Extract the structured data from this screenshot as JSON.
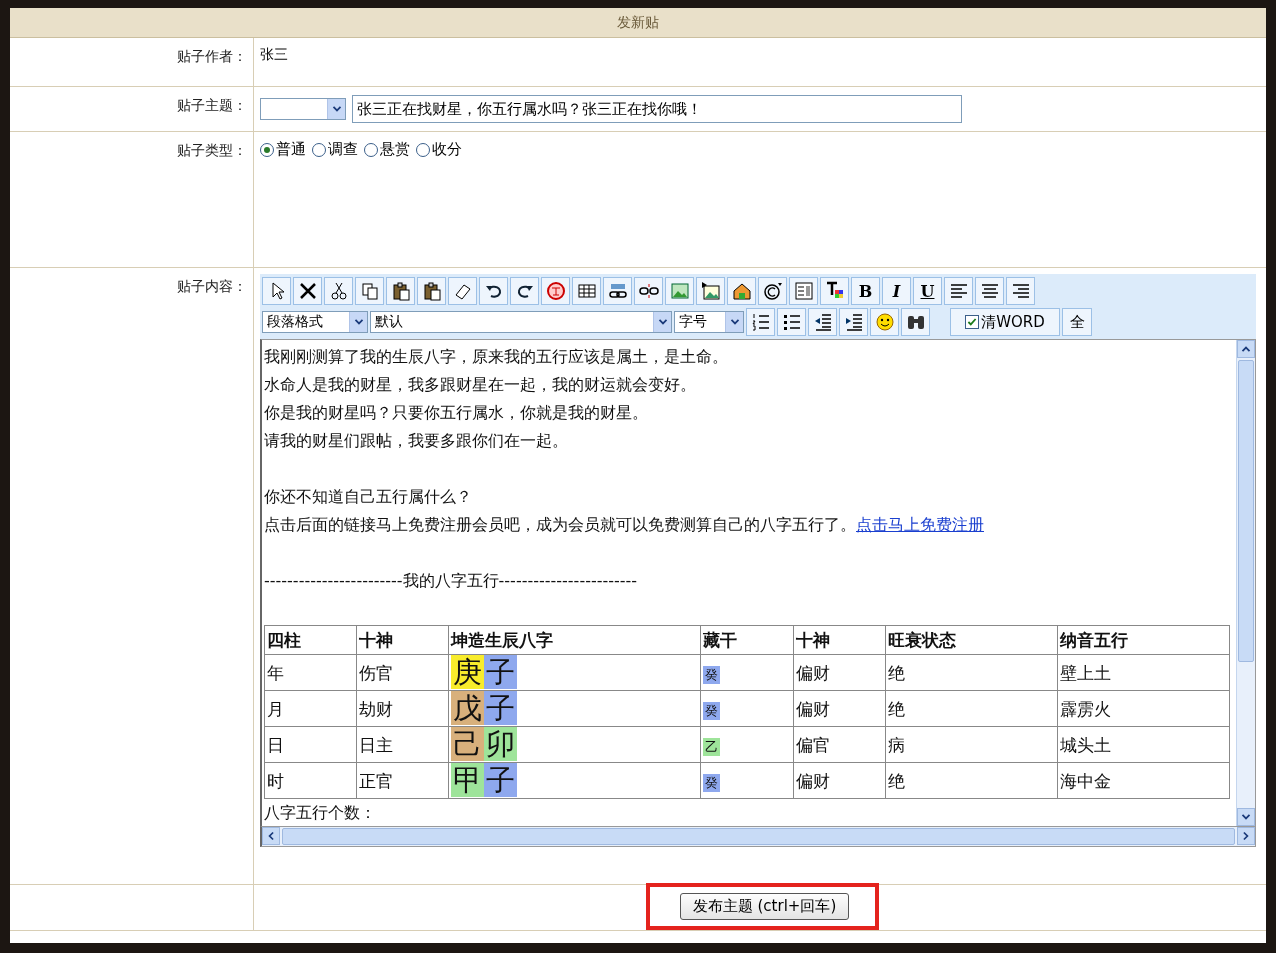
{
  "title": "发新贴",
  "author": {
    "label": "贴子作者：",
    "value": "张三"
  },
  "subject": {
    "label": "贴子主题：",
    "value": "张三正在找财星，你五行属水吗？张三正在找你哦！"
  },
  "post_type": {
    "label": "贴子类型：",
    "options": [
      {
        "label": "普通",
        "selected": true
      },
      {
        "label": "调查",
        "selected": false
      },
      {
        "label": "悬赏",
        "selected": false
      },
      {
        "label": "收分",
        "selected": false
      }
    ]
  },
  "content": {
    "label": "贴子内容：",
    "format_buttons": [
      "B",
      "I",
      "U"
    ],
    "paragraph_select": "段落格式",
    "font_select": "默认",
    "size_select": "字号",
    "clean_word": {
      "label": "清WORD",
      "checked": true
    },
    "select_all": "全",
    "body": [
      {
        "kind": "text",
        "text": "我刚刚测算了我的生辰八字，原来我的五行应该是属土，是土命。"
      },
      {
        "kind": "text",
        "text": "水命人是我的财星，我多跟财星在一起，我的财运就会变好。"
      },
      {
        "kind": "text",
        "text": "你是我的财星吗？只要你五行属水，你就是我的财星。"
      },
      {
        "kind": "text",
        "text": "请我的财星们跟帖，我要多跟你们在一起。"
      },
      {
        "kind": "blank"
      },
      {
        "kind": "text",
        "text": "你还不知道自己五行属什么？"
      },
      {
        "kind": "link",
        "text": "点击后面的链接马上免费注册会员吧，成为会员就可以免费测算自己的八字五行了。",
        "link": "点击马上免费注册"
      },
      {
        "kind": "blank"
      },
      {
        "kind": "text",
        "text": "------------------------我的八字五行------------------------"
      },
      {
        "kind": "blank"
      }
    ],
    "table": {
      "columns": [
        "四柱",
        "十神",
        "坤造生辰八字",
        "藏干",
        "十神",
        "旺衰状态",
        "纳音五行"
      ],
      "rows": [
        {
          "pillar": "年",
          "ten_god": "伤官",
          "bazi": [
            {
              "char": "庚",
              "color": "#f8ec2c"
            },
            {
              "char": "子",
              "color": "#8ea8ee"
            }
          ],
          "hidden_stem": {
            "char": "癸",
            "color": "#8ea8ee"
          },
          "hidden_ten_god": "偏财",
          "state": "绝",
          "nayin": "壁上土"
        },
        {
          "pillar": "月",
          "ten_god": "劫财",
          "bazi": [
            {
              "char": "戊",
              "color": "#d8b07c"
            },
            {
              "char": "子",
              "color": "#8ea8ee"
            }
          ],
          "hidden_stem": {
            "char": "癸",
            "color": "#8ea8ee"
          },
          "hidden_ten_god": "偏财",
          "state": "绝",
          "nayin": "霹雳火"
        },
        {
          "pillar": "日",
          "ten_god": "日主",
          "bazi": [
            {
              "char": "己",
              "color": "#d8b07c"
            },
            {
              "char": "卯",
              "color": "#9ee49a"
            }
          ],
          "hidden_stem": {
            "char": "乙",
            "color": "#9ee49a"
          },
          "hidden_ten_god": "偏官",
          "state": "病",
          "nayin": "城头土"
        },
        {
          "pillar": "时",
          "ten_god": "正官",
          "bazi": [
            {
              "char": "甲",
              "color": "#9ee49a"
            },
            {
              "char": "子",
              "color": "#8ea8ee"
            }
          ],
          "hidden_stem": {
            "char": "癸",
            "color": "#8ea8ee"
          },
          "hidden_ten_god": "偏财",
          "state": "绝",
          "nayin": "海中金"
        }
      ]
    },
    "footer_text": "八字五行个数："
  },
  "submit": {
    "label": "发布主题 (ctrl+回车)",
    "highlighted": true
  }
}
